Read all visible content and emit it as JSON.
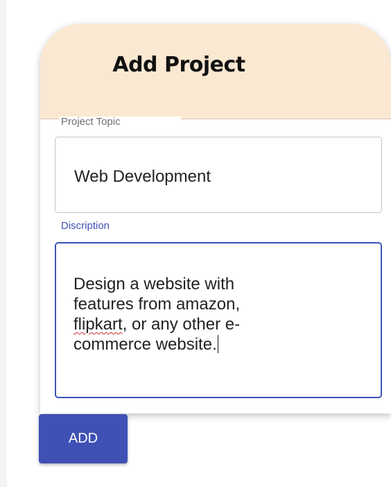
{
  "dialog": {
    "title": "Add Project",
    "topic": {
      "label": "Project Topic",
      "value": "Web Development"
    },
    "description": {
      "label": "Discription",
      "lines": {
        "line1": "Design a website with",
        "line2": "features from amazon,",
        "misspelled_word": "flipkart",
        "line3_rest": ", or any other e-",
        "line4": "commerce website."
      }
    },
    "add_button_label": "ADD"
  },
  "colors": {
    "header_bg": "#fbe8d2",
    "accent": "#3f51b5",
    "muted_label": "#6f6f6f"
  }
}
